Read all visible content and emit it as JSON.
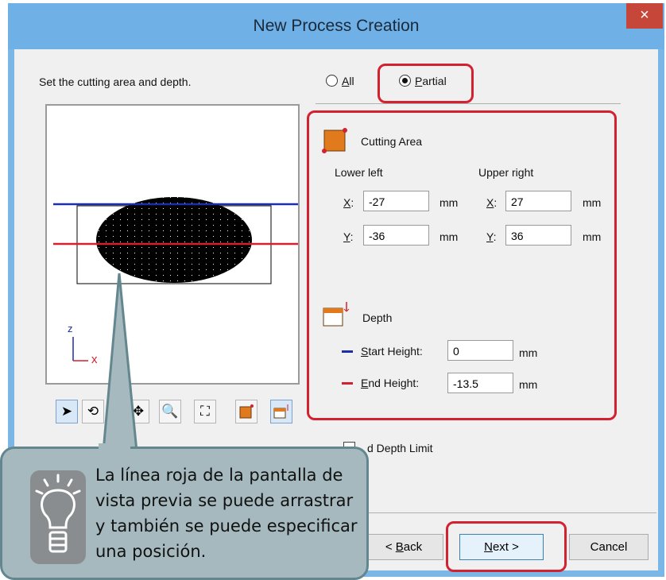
{
  "window": {
    "title": "New Process Creation",
    "close_glyph": "×"
  },
  "instruction": "Set the cutting area and depth.",
  "mode": {
    "all": {
      "label": "All",
      "hotkey": "A",
      "rest": "ll"
    },
    "partial": {
      "label": "Partial",
      "hotkey": "P",
      "rest": "artial",
      "selected": true
    }
  },
  "cutting_area": {
    "title": "Cutting Area",
    "lower_left": {
      "label": "Lower left",
      "x": "-27",
      "y": "-36"
    },
    "upper_right": {
      "label": "Upper right",
      "x": "27",
      "y": "36"
    },
    "x_label": "X",
    "y_label": "Y",
    "colon": ":",
    "unit": "mm"
  },
  "depth": {
    "title": "Depth",
    "start": {
      "hotkey": "S",
      "rest": "tart Height:",
      "value": "0",
      "unit": "mm",
      "color": "#1c2fa8"
    },
    "end": {
      "hotkey": "E",
      "rest": "nd Height:",
      "value": "-13.5",
      "unit": "mm",
      "color": "#d42130"
    }
  },
  "depth_limit_label": "d Depth Limit",
  "preview": {
    "axis_z": "z",
    "axis_x": "x"
  },
  "toolbar": [
    "select-arrow-icon",
    "rotate-icon",
    "pan-icon",
    "zoom-icon",
    "fit-view-icon",
    "cutting-area-tool-icon",
    "depth-tool-icon"
  ],
  "buttons": {
    "back": {
      "lead": "< ",
      "hotkey": "B",
      "rest": "ack"
    },
    "next": {
      "hotkey": "N",
      "rest": "ext >"
    },
    "cancel": "Cancel"
  },
  "tip": {
    "text": "La línea roja de la pantalla de vista previa se puede arrastrar y también se puede especificar una posición.",
    "icon": "lightbulb-icon"
  },
  "colors": {
    "highlight": "#d42130",
    "titlebar": "#6fb0e6",
    "callout": "#a6b9be",
    "blue_line": "#1c2fa8",
    "red_line": "#d42130"
  }
}
